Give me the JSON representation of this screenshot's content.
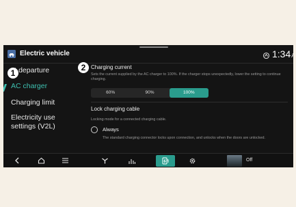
{
  "header": {
    "app_title": "Electric vehicle",
    "app_icon": "ev-app-icon",
    "status_icon": "connected-car-icon",
    "time": "1:34",
    "ampm": "AM"
  },
  "callouts": {
    "first": "1",
    "second": "2"
  },
  "sidebar": {
    "items": [
      {
        "label": "xt departure",
        "active": false
      },
      {
        "label": "AC charger",
        "active": true
      },
      {
        "label": "Charging limit",
        "active": false
      },
      {
        "label": "Electricity use settings (V2L)",
        "active": false
      }
    ]
  },
  "charging_current": {
    "title": "Charging current",
    "description": "Sets the current supplied by the AC charger to 100%. If the charger stops unexpectedly, lower the setting to continue charging.",
    "options": [
      "60%",
      "90%",
      "100%"
    ],
    "selected": "100%"
  },
  "lock_cable": {
    "title": "Lock charging cable",
    "description": "Locking mode for a connected charging cable.",
    "option_label": "Always",
    "option_description": "The standard charging connector locks upon connection, and unlocks when the doors are unlocked."
  },
  "bottom_bar": {
    "icons": [
      "back-icon",
      "home-icon",
      "menu-icon",
      "fan-icon",
      "media-icon",
      "ev-charging-icon",
      "settings-gear-icon"
    ],
    "media_status": "Off"
  },
  "colors": {
    "accent": "#3ec0b0",
    "selected_fill": "#2a9c8d",
    "screen_bg": "#141414",
    "page_bg": "#f6f0e6"
  }
}
